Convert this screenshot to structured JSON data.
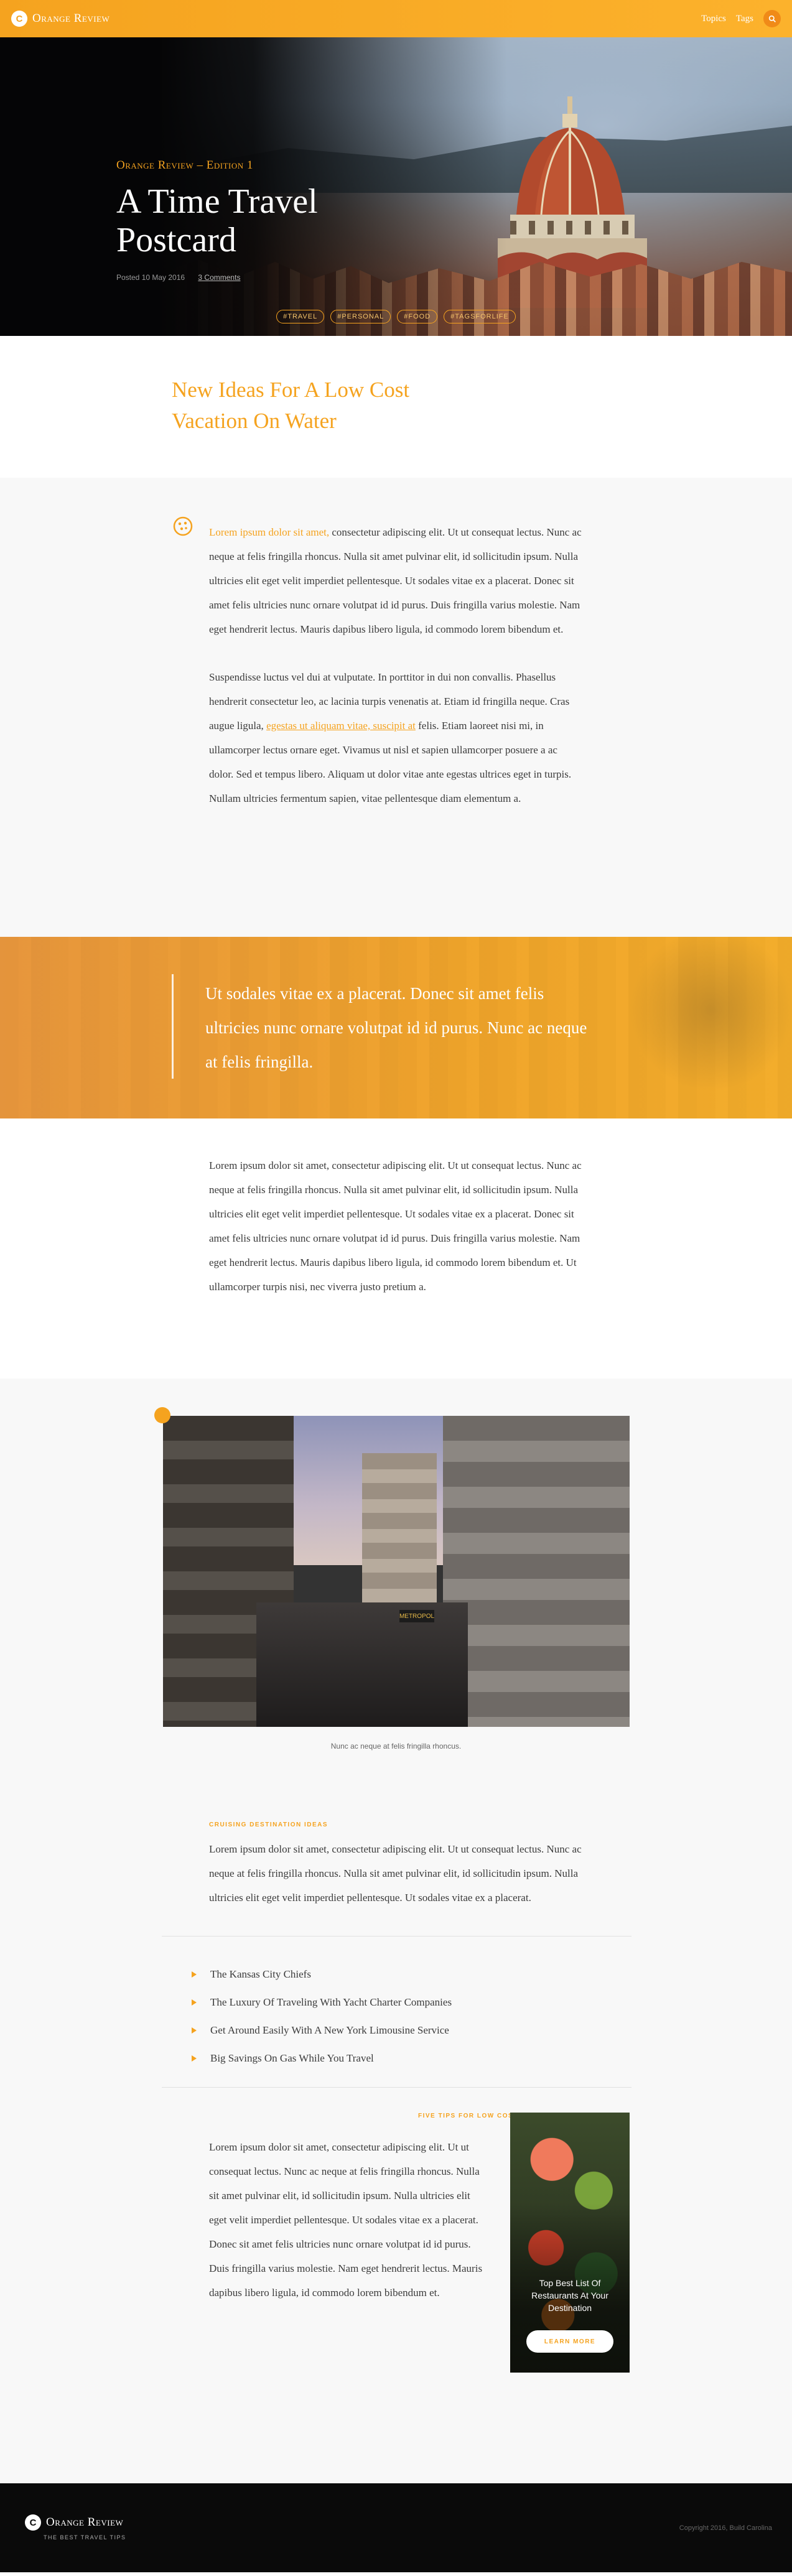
{
  "header": {
    "brand": "Orange Review",
    "nav": [
      "Topics",
      "Tags"
    ]
  },
  "hero": {
    "kicker": "Orange Review – Edition 1",
    "title": "A Time Travel Postcard",
    "posted": "Posted 10 May 2016",
    "comments": "3 Comments",
    "tags": [
      "#Travel",
      "#Personal",
      "#Food",
      "#TagsForLife"
    ]
  },
  "section_title": "New Ideas For A Low Cost Vacation On Water",
  "intro": {
    "lead_link": "Lorem ipsum dolor sit amet,",
    "p1_rest": " consectetur adipiscing elit. Ut ut consequat lectus. Nunc ac neque at felis fringilla rhoncus. Nulla sit amet pulvinar elit, id sollicitudin ipsum. Nulla ultricies elit eget velit imperdiet pellentesque. Ut sodales vitae ex a placerat. Donec sit amet felis ultricies nunc ornare volutpat id id purus. Duis fringilla varius molestie. Nam eget hendrerit lectus. Mauris dapibus libero ligula, id commodo lorem bibendum et.",
    "p2_before": "Suspendisse luctus vel dui at vulputate. In porttitor in dui non convallis. Phasellus hendrerit consectetur leo, ac lacinia turpis venenatis at. Etiam id fringilla neque. Cras augue ligula, ",
    "p2_link": "egestas ut aliquam vitae, suscipit at",
    "p2_after": " felis. Etiam laoreet nisi mi, in ullamcorper lectus ornare eget. Vivamus ut nisl et sapien ullamcorper posuere a ac dolor. Sed et tempus libero. Aliquam ut dolor vitae ante egestas ultrices eget in turpis. Nullam ultricies fermentum sapien, vitae pellentesque diam elementum a."
  },
  "quote": "Ut sodales vitae ex a placerat. Donec sit amet felis ultricies nunc ornare volutpat id id purus. Nunc ac neque at felis fringilla.",
  "body2": "Lorem ipsum dolor sit amet, consectetur adipiscing elit. Ut ut consequat lectus. Nunc ac neque at felis fringilla rhoncus. Nulla sit amet pulvinar elit, id sollicitudin ipsum. Nulla ultricies elit eget velit imperdiet pellentesque. Ut sodales vitae ex a placerat. Donec sit amet felis ultricies nunc ornare volutpat id id purus. Duis fringilla varius molestie. Nam eget hendrerit lectus. Mauris dapibus libero ligula, id commodo lorem bibendum et. Ut ullamcorper turpis nisi, nec viverra justo pretium a.",
  "figure": {
    "sign": "METROPOL",
    "caption": "Nunc ac neque at felis fringilla rhoncus."
  },
  "cruising": {
    "eyebrow": "Cruising Destination Ideas",
    "text": "Lorem ipsum dolor sit amet, consectetur adipiscing elit. Ut ut consequat lectus. Nunc ac neque at felis fringilla rhoncus. Nulla sit amet pulvinar elit, id sollicitudin ipsum. Nulla ultricies elit eget velit imperdiet pellentesque. Ut sodales vitae ex a placerat."
  },
  "list": [
    "The Kansas City Chiefs",
    "The Luxury Of Traveling With Yacht Charter Companies",
    "Get Around Easily With A New York Limousine Service",
    "Big Savings On Gas While You Travel"
  ],
  "tips": {
    "eyebrow": "Five Tips For Low Cost Holidays",
    "text": "Lorem ipsum dolor sit amet, consectetur adipiscing elit. Ut ut consequat lectus. Nunc ac neque at felis fringilla rhoncus. Nulla sit amet pulvinar elit, id sollicitudin ipsum. Nulla ultricies elit eget velit imperdiet pellentesque. Ut sodales vitae ex a placerat. Donec sit amet felis ultricies nunc ornare volutpat id id purus. Duis fringilla varius molestie. Nam eget hendrerit lectus. Mauris dapibus libero ligula, id commodo lorem bibendum et."
  },
  "ad": {
    "text": "Top Best List Of Restaurants At Your Destination",
    "button": "Learn More"
  },
  "footer": {
    "brand": "Orange Review",
    "tagline": "The Best Travel Tips",
    "copyright": "Copyright 2016, Build Carolina"
  },
  "colors": {
    "accent": "#f5a31f",
    "footer_bg": "#0a0a0a",
    "section_grey": "#f8f8f8"
  }
}
